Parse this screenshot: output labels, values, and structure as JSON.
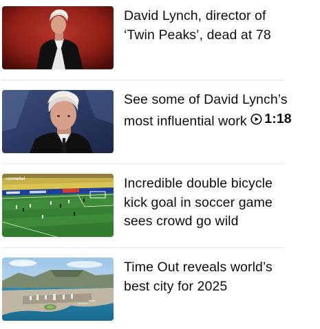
{
  "articles": [
    {
      "headline": "David Lynch, director of ‘Twin Peaks’, dead at 78",
      "thumbnail": "portrait-man-red-background",
      "has_video": false
    },
    {
      "headline": "See some of David Lynch’s most influential work",
      "thumbnail": "portrait-man-gray-hair",
      "has_video": true,
      "video_duration": "1:18",
      "video_icon": "play-circle-icon"
    },
    {
      "headline": "Incredible double bicycle kick goal in soccer game sees crowd go wild",
      "thumbnail": "soccer-stadium-field",
      "thumbnail_watermark": "conmebol"
    },
    {
      "headline": "Time Out reveals world’s best city for 2025",
      "thumbnail": "coastal-city-aerial-view",
      "has_video": false
    }
  ],
  "colors": {
    "text": "#0c0c0c",
    "divider": "#e6e6e6",
    "background": "#ffffff"
  }
}
